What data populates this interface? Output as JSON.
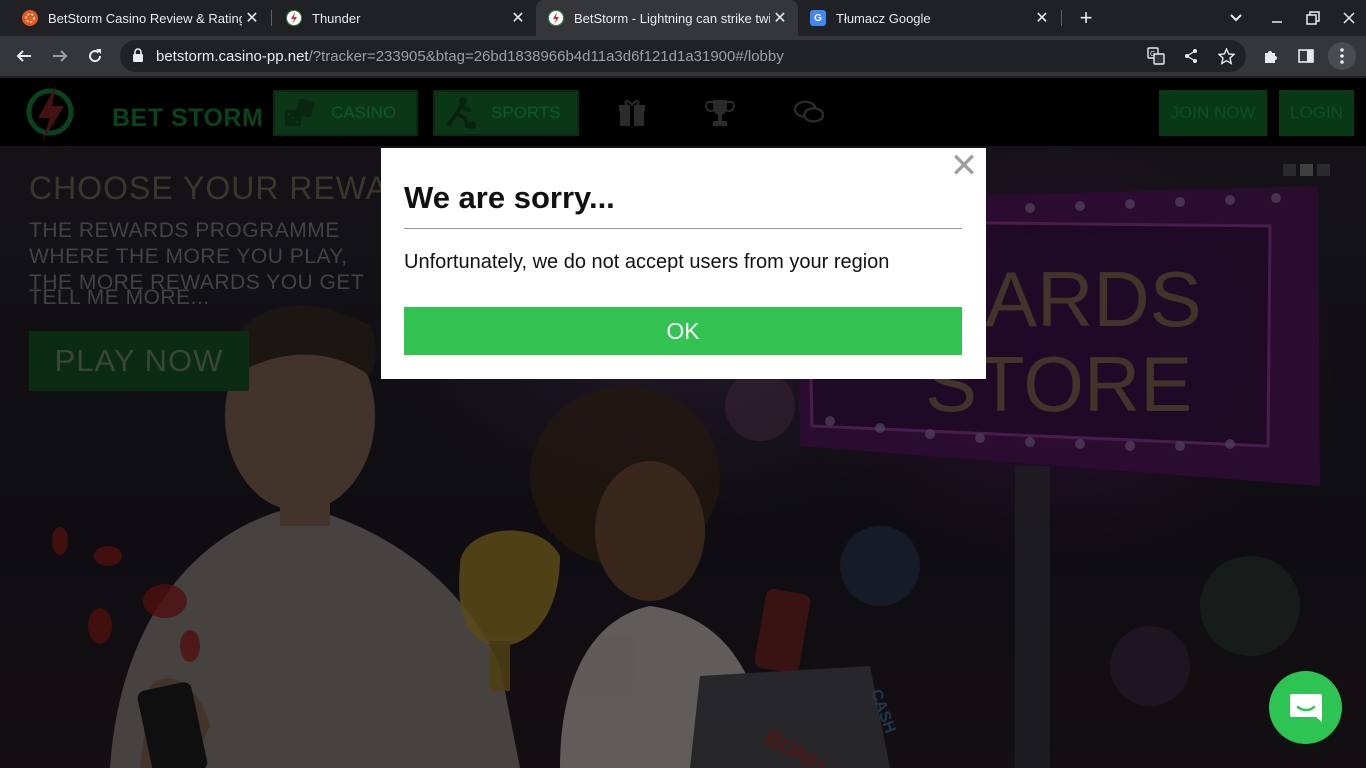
{
  "browser": {
    "tabs": [
      {
        "title": "BetStorm Casino Review & Rating",
        "favicon": "orange-chip-icon",
        "active": false
      },
      {
        "title": "Thunder",
        "favicon": "betstorm-bolt-icon",
        "active": false
      },
      {
        "title": "BetStorm - Lightning can strike twice",
        "favicon": "betstorm-bolt-icon",
        "active": true
      },
      {
        "title": "Tłumacz Google",
        "favicon": "google-translate-icon",
        "active": false
      }
    ],
    "url_host": "betstorm.casino-pp.net",
    "url_path": "/?tracker=233905&btag=26bd1838966b4d11a3d6f121d1a31900#/lobby"
  },
  "site": {
    "logo_text": "BET STORM",
    "nav": {
      "casino": "CASINO",
      "sports": "SPORTS",
      "join": "JOIN NOW",
      "login": "LOGIN"
    },
    "hero": {
      "title": "CHOOSE YOUR REWARDS",
      "subtitle": "THE REWARDS PROGRAMME WHERE THE MORE YOU PLAY, THE MORE REWARDS YOU GET",
      "more": "TELL ME MORE...",
      "play": "PLAY NOW",
      "sign_text": "REWARDS STORE"
    }
  },
  "modal": {
    "title": "We are sorry...",
    "message": "Unfortunately, we do not accept users from your region",
    "ok": "OK",
    "close": "✕"
  },
  "colors": {
    "ok_green": "#33c353",
    "chat_green": "#2ec453",
    "brand_green": "#0f7a35"
  }
}
